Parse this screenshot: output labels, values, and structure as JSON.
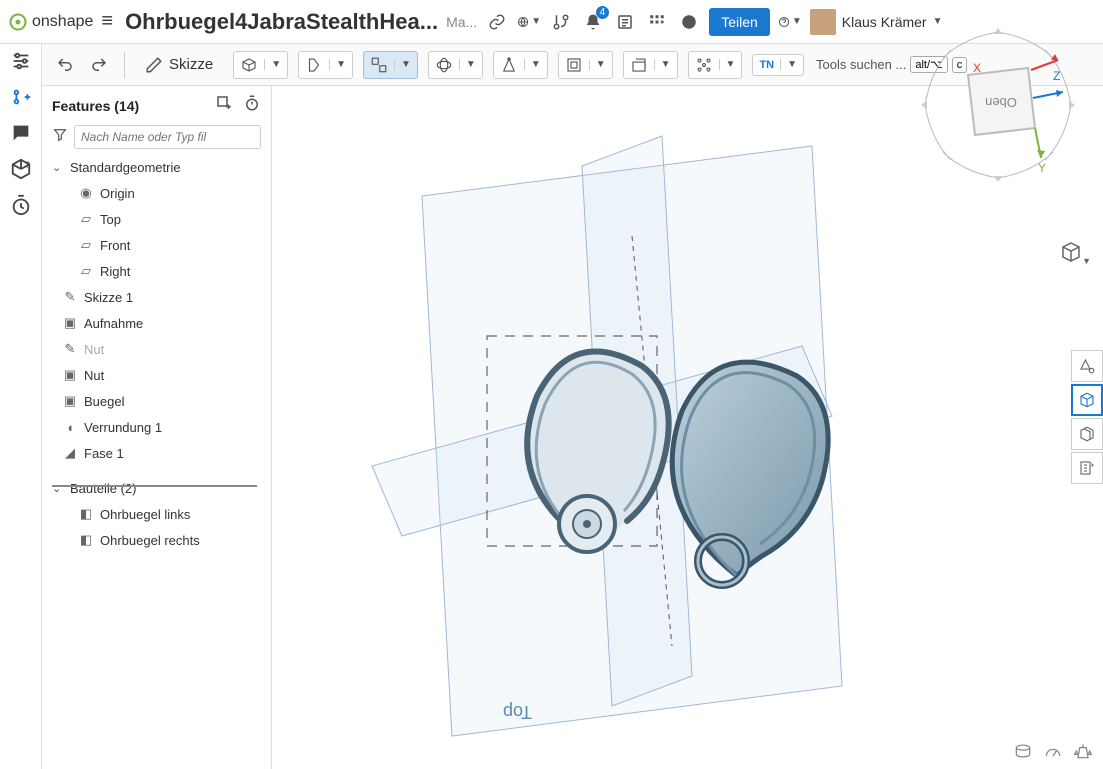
{
  "header": {
    "brand": "onshape",
    "doc_title": "Ohrbuegel4JabraStealthHea...",
    "doc_sub": "Ma...",
    "notifications_count": "4",
    "share_label": "Teilen",
    "user_name": "Klaus Krämer"
  },
  "toolbar": {
    "sketch_label": "Skizze",
    "search_label": "Tools suchen ...",
    "kbd1": "alt/⌥",
    "kbd2": "c"
  },
  "features": {
    "title": "Features (14)",
    "filter_placeholder": "Nach Name oder Typ fil",
    "default_geom": "Standardgeometrie",
    "items_geom": [
      {
        "label": "Origin",
        "icon": "origin"
      },
      {
        "label": "Top",
        "icon": "plane"
      },
      {
        "label": "Front",
        "icon": "plane"
      },
      {
        "label": "Right",
        "icon": "plane"
      }
    ],
    "items_feat": [
      {
        "label": "Skizze 1",
        "icon": "pencil"
      },
      {
        "label": "Aufnahme",
        "icon": "extrude"
      },
      {
        "label": "Nut",
        "icon": "pencil",
        "muted": true
      },
      {
        "label": "Nut",
        "icon": "extrude"
      },
      {
        "label": "Buegel",
        "icon": "extrude"
      },
      {
        "label": "Verrundung 1",
        "icon": "fillet"
      },
      {
        "label": "Fase 1",
        "icon": "chamfer"
      }
    ],
    "parts_title": "Bauteile (2)",
    "parts": [
      {
        "label": "Ohrbuegel links"
      },
      {
        "label": "Ohrbuegel rechts"
      }
    ]
  },
  "viewcube": {
    "face": "Oben",
    "x": "X",
    "y": "Y",
    "z": "Z"
  },
  "canvas": {
    "plane_label": "Top"
  }
}
